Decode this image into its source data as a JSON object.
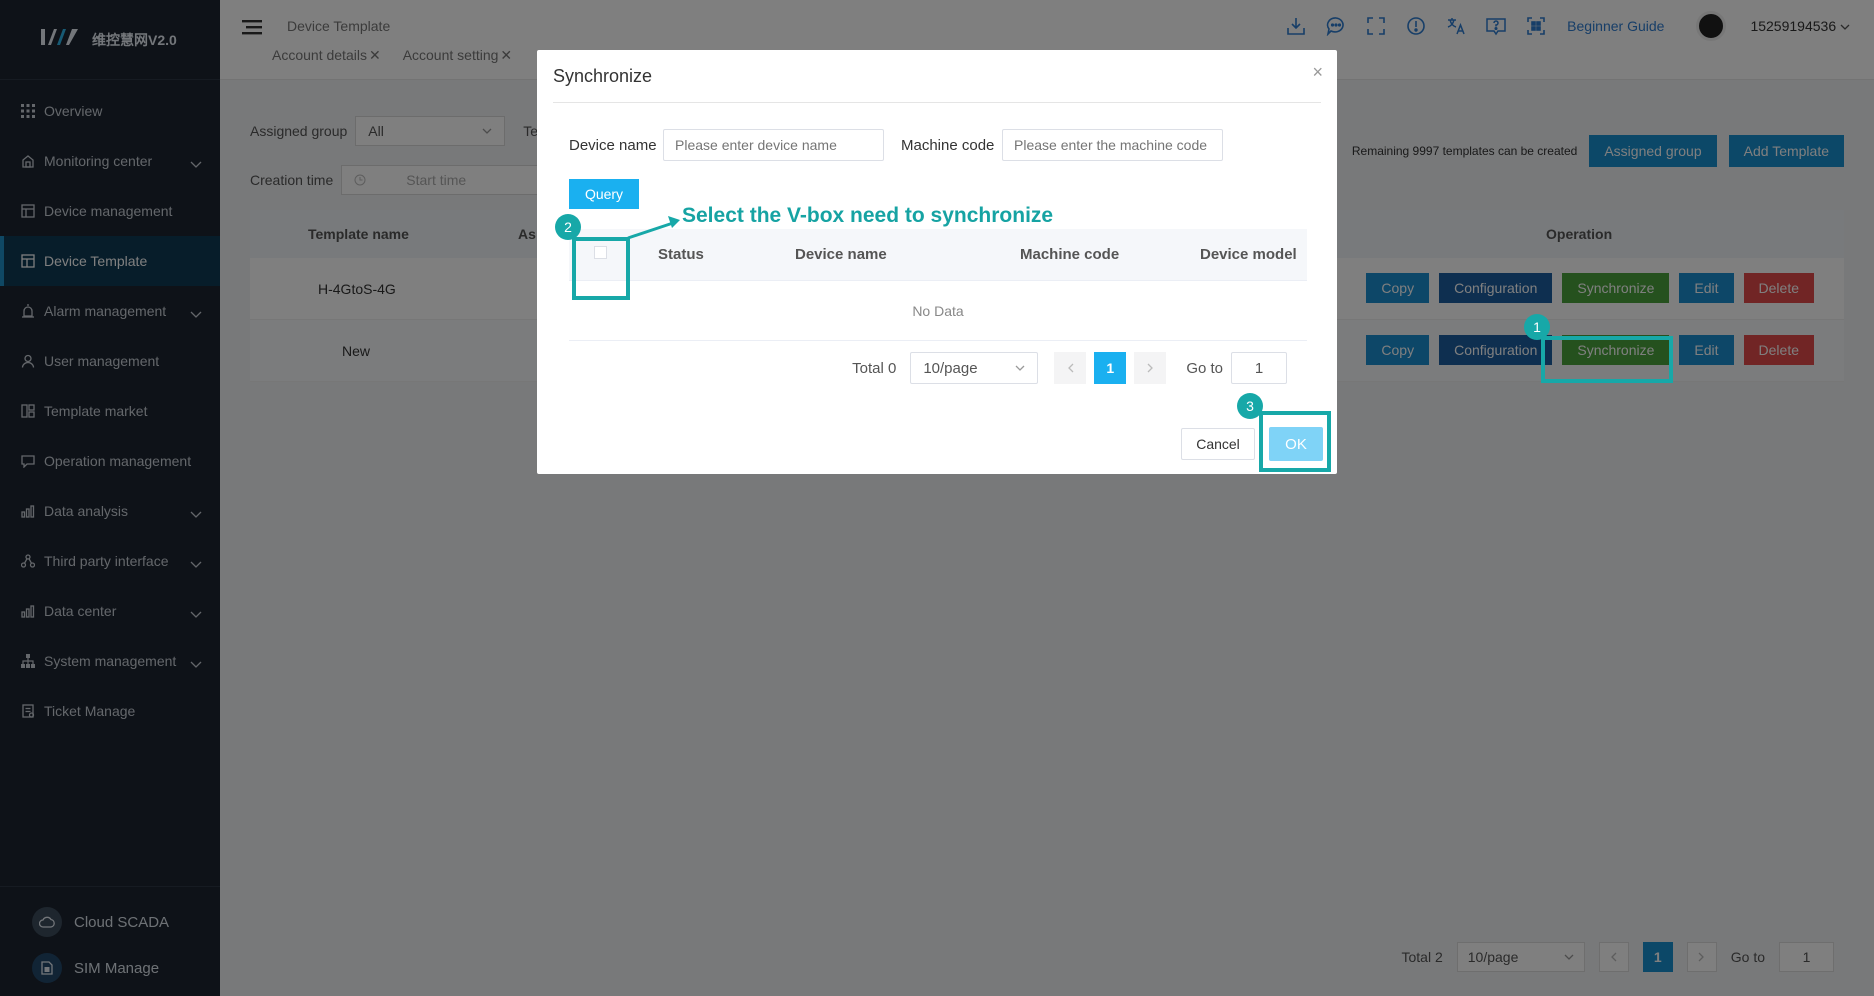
{
  "app": {
    "logo_mark": "K",
    "logo_text": "维控慧网V2.0"
  },
  "sidebar": {
    "items": [
      {
        "label": "Overview",
        "icon": "grid-icon",
        "chevron": false
      },
      {
        "label": "Monitoring center",
        "icon": "monitor-icon",
        "chevron": true
      },
      {
        "label": "Device management",
        "icon": "device-icon",
        "chevron": false
      },
      {
        "label": "Device Template",
        "icon": "template-icon",
        "chevron": false,
        "active": true
      },
      {
        "label": "Alarm management",
        "icon": "alarm-icon",
        "chevron": true
      },
      {
        "label": "User management",
        "icon": "user-icon",
        "chevron": false
      },
      {
        "label": "Template market",
        "icon": "market-icon",
        "chevron": false
      },
      {
        "label": "Operation management",
        "icon": "chat-icon",
        "chevron": false
      },
      {
        "label": "Data analysis",
        "icon": "bar-chart-icon",
        "chevron": true
      },
      {
        "label": "Third party interface",
        "icon": "network-icon",
        "chevron": true
      },
      {
        "label": "Data center",
        "icon": "bar-chart-icon",
        "chevron": true
      },
      {
        "label": "System management",
        "icon": "hierarchy-icon",
        "chevron": true
      },
      {
        "label": "Ticket Manage",
        "icon": "ticket-icon",
        "chevron": false
      }
    ],
    "footer": {
      "cloud_label": "Cloud SCADA",
      "sim_label": "SIM Manage"
    }
  },
  "header": {
    "breadcrumb": "Device Template",
    "tabs": [
      "Account details",
      "Account setting"
    ],
    "close_glyph": "✕",
    "guide_label": "Beginner Guide",
    "username": "15259194536"
  },
  "page": {
    "assigned_group_label": "Assigned group",
    "assigned_group_value": "All",
    "template_label_partial": "Te",
    "creation_time_label": "Creation time",
    "start_time_placeholder": "Start time",
    "remaining_text": "Remaining 9997 templates can be created",
    "assigned_group_button": "Assigned group",
    "add_template_button": "Add Template",
    "columns": {
      "template_name": "Template name",
      "assigned_partial": "As",
      "operation": "Operation"
    },
    "rows": [
      {
        "name": "H-4GtoS-4G"
      },
      {
        "name": "New"
      }
    ],
    "ops": {
      "copy": "Copy",
      "configuration": "Configuration",
      "synchronize": "Synchronize",
      "edit": "Edit",
      "delete": "Delete"
    },
    "pager": {
      "total": "Total 2",
      "page_size": "10/page",
      "current": "1",
      "goto_label": "Go to",
      "goto_value": "1"
    }
  },
  "dialog": {
    "title": "Synchronize",
    "close_glyph": "×",
    "device_name_label": "Device name",
    "device_name_placeholder": "Please enter device name",
    "machine_code_label": "Machine code",
    "machine_code_placeholder": "Please enter the machine code",
    "query_button": "Query",
    "columns": {
      "status": "Status",
      "device_name": "Device name",
      "machine_code": "Machine code",
      "device_model": "Device model"
    },
    "empty_text": "No Data",
    "pager": {
      "total": "Total 0",
      "page_size": "10/page",
      "current": "1",
      "goto_label": "Go to",
      "goto_value": "1"
    },
    "cancel_button": "Cancel",
    "ok_button": "OK"
  },
  "annotations": {
    "step1": "1",
    "step2": "2",
    "step3": "3",
    "step2_text": "Select the V-box need to synchronize",
    "color": "#17a8a8"
  },
  "colors": {
    "sidebar_bg": "#1c2530",
    "primary": "#1890d0",
    "sync_green": "#4ba33c",
    "delete_red": "#e24b4b",
    "config_navy": "#1c5ea0"
  }
}
